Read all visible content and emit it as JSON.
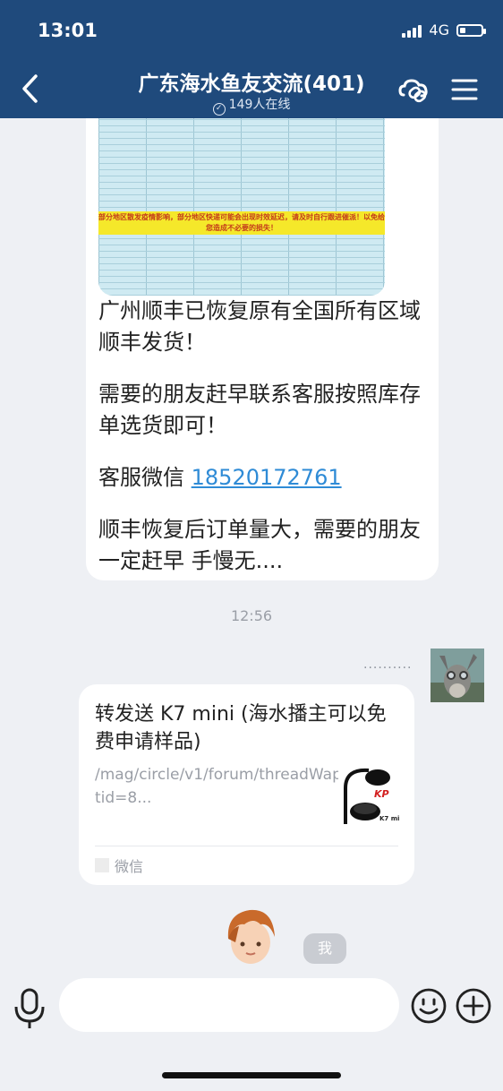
{
  "status_bar": {
    "time": "13:01",
    "network": "4G",
    "battery_level": 0.25
  },
  "header": {
    "title": "广东海水鱼友交流(401)",
    "online": "149人在线",
    "icons": [
      "back-icon",
      "check-circle-icon",
      "link-cloud-icon",
      "menu-icon"
    ]
  },
  "thumbnail": {
    "notice": "部分地区散发疫情影响，部分地区快递可能会出现时效延迟，请及时自行跟进催派！以免给您造成不必要的损失！"
  },
  "message1": {
    "p1": "广州顺丰已恢复原有全国所有区域顺丰发货！",
    "p2": "需要的朋友赶早联系客服按照库存单选货即可！",
    "p3_prefix": "客服微信 ",
    "p3_link": "18520172761",
    "p4": "顺丰恢复后订单量大，需要的朋友一定赶早 手慢无...."
  },
  "timestamp": "12:56",
  "typing_dots": "··········",
  "card": {
    "title": "转发送 K7 mini (海水播主可以免费申请样品)",
    "desc": "/mag/circle/v1/forum/threadWapPage?tid=8...",
    "image_brand": "KP",
    "image_model": "K7 mini",
    "source": "微信"
  },
  "me_label": "我",
  "input": {
    "placeholder": ""
  },
  "colors": {
    "header_bg": "#1f4a7c",
    "link": "#2f8bd6",
    "chat_bg": "#eef0f4"
  }
}
